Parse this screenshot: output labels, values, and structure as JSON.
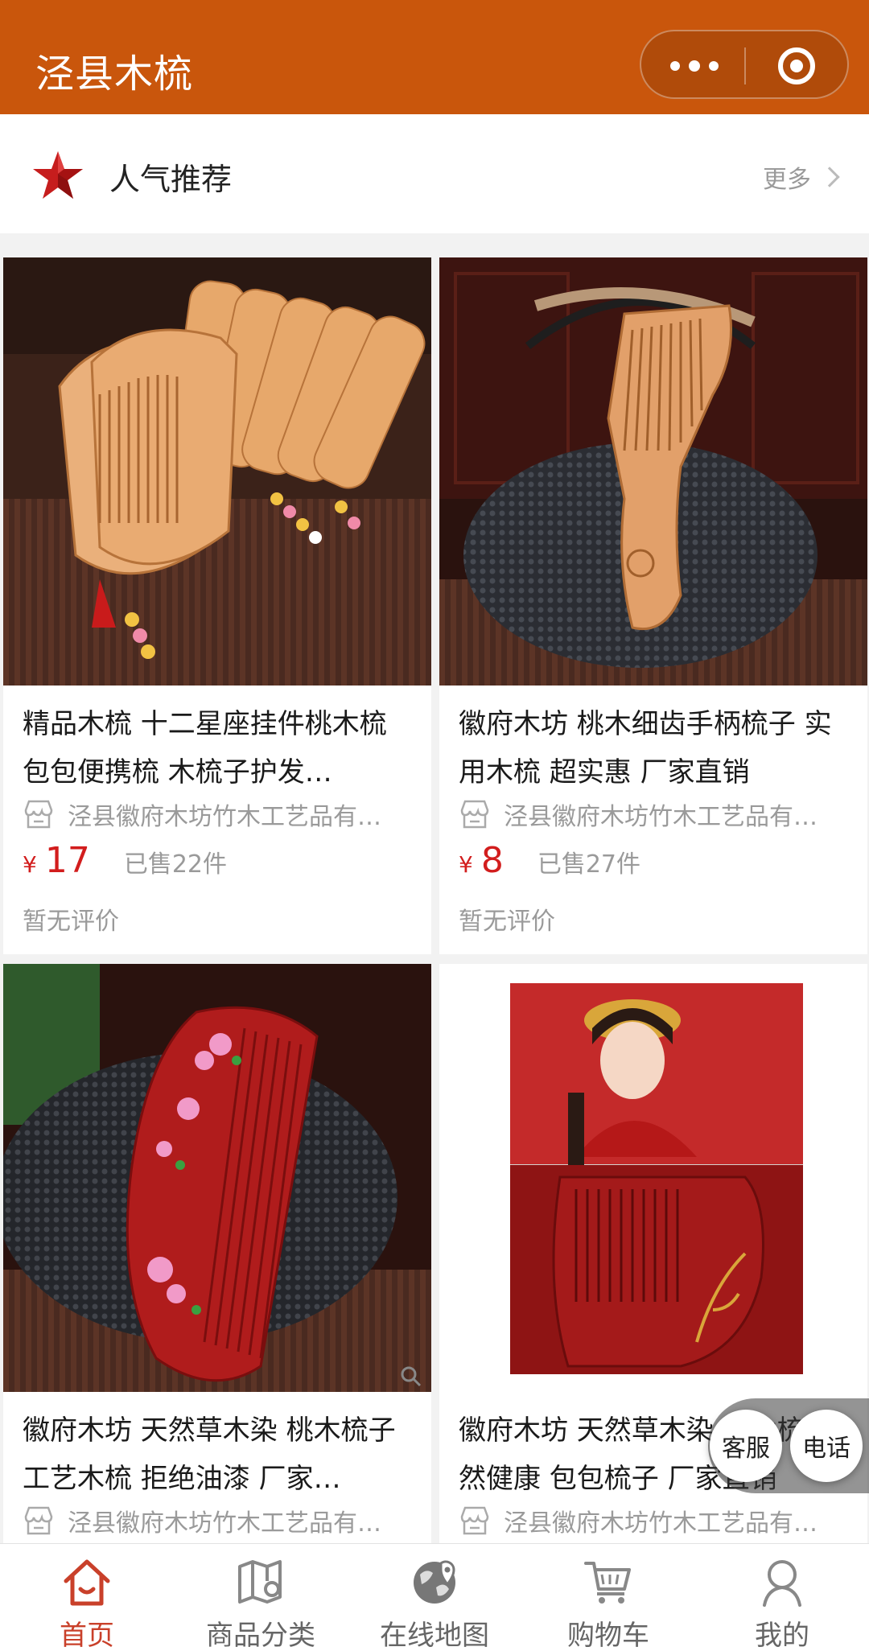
{
  "header": {
    "title": "泾县木梳",
    "menu_icon": "more-dots-icon",
    "close_icon": "target-close-icon",
    "color": "#c9560c"
  },
  "section": {
    "icon": "red-star-icon",
    "title": "人气推荐",
    "more_label": "更多"
  },
  "products": [
    {
      "title": "精品木梳 十二星座挂件桃木梳 包包便携梳 木梳子护发…",
      "shop": "泾县徽府木坊竹木工艺品有…",
      "currency": "¥",
      "price": "17",
      "sold": "已售22件",
      "rating": "暂无评价"
    },
    {
      "title": "徽府木坊 桃木细齿手柄梳子 实用木梳 超实惠 厂家直销",
      "shop": "泾县徽府木坊竹木工艺品有…",
      "currency": "¥",
      "price": "8",
      "sold": "已售27件",
      "rating": "暂无评价"
    },
    {
      "title": "徽府木坊 天然草木染 桃木梳子工艺木梳 拒绝油漆 厂家…",
      "shop": "泾县徽府木坊竹木工艺品有…"
    },
    {
      "title": "徽府木坊 天然草木染 桃木梳 自然健康 包包梳子 厂家直销",
      "shop": "泾县徽府木坊竹木工艺品有…"
    }
  ],
  "float_buttons": {
    "service": "客服",
    "phone": "电话"
  },
  "tabbar": {
    "items": [
      {
        "label": "首页",
        "icon": "home-icon",
        "active": true
      },
      {
        "label": "商品分类",
        "icon": "category-map-icon",
        "active": false
      },
      {
        "label": "在线地图",
        "icon": "globe-location-icon",
        "active": false
      },
      {
        "label": "购物车",
        "icon": "cart-icon",
        "active": false
      },
      {
        "label": "我的",
        "icon": "user-icon",
        "active": false
      }
    ],
    "active_color": "#c9402a",
    "inactive_color": "#666666"
  }
}
